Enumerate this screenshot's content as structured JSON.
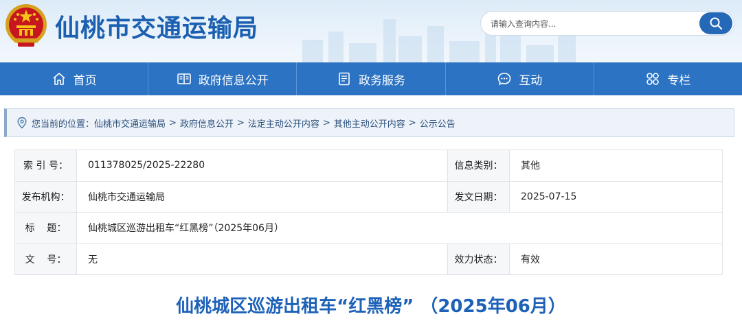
{
  "header": {
    "site_title": "仙桃市交通运输局",
    "search_placeholder": "请输入查询内容..."
  },
  "nav": [
    {
      "label": "首页",
      "icon": "home-icon"
    },
    {
      "label": "政府信息公开",
      "icon": "book-icon"
    },
    {
      "label": "政务服务",
      "icon": "document-icon"
    },
    {
      "label": "互动",
      "icon": "chat-icon"
    },
    {
      "label": "专栏",
      "icon": "grid-icon"
    }
  ],
  "breadcrumb": {
    "prefix": "您当前的位置：",
    "items": [
      "仙桃市交通运输局",
      "政府信息公开",
      "法定主动公开内容",
      "其他主动公开内容",
      "公示公告"
    ],
    "separator": ">"
  },
  "info": {
    "index_label": "索 引 号：",
    "index_value": "011378025/2025-22280",
    "category_label": "信息类别：",
    "category_value": "其他",
    "publisher_label": "发布机构：",
    "publisher_value": "仙桃市交通运输局",
    "date_label": "发文日期：",
    "date_value": "2025-07-15",
    "title_label": "标    题：",
    "title_value": "仙桃城区巡游出租车“红黑榜”（2025年06月）",
    "docno_label": "文    号：",
    "docno_value": "无",
    "status_label": "效力状态：",
    "status_value": "有效"
  },
  "article": {
    "title": "仙桃城区巡游出租车“红黑榜” （2025年06月）"
  }
}
